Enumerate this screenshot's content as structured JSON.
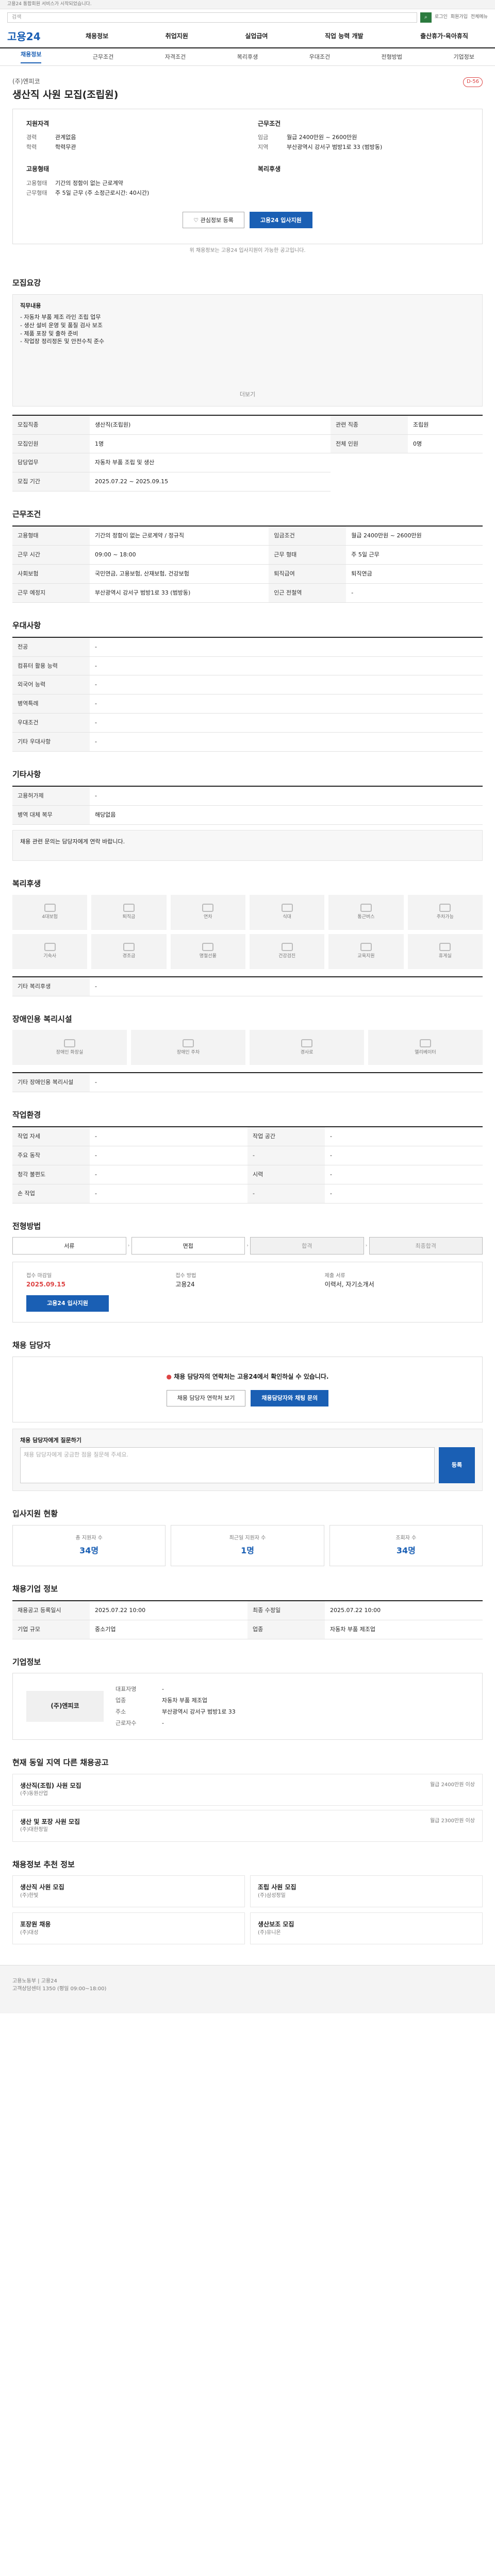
{
  "top": {
    "notice": "고용24 통합회원 서비스가 시작되었습니다.",
    "search_placeholder": "검색",
    "search_btn": "검색",
    "links": [
      "로그인",
      "회원가입",
      "전체메뉴"
    ]
  },
  "gnb": {
    "logo": "고용24",
    "items": [
      "채용정보",
      "취업지원",
      "실업급여",
      "직업 능력 개발",
      "출산휴가·육아휴직"
    ]
  },
  "tabs": [
    "채용정보",
    "근무조건",
    "자격조건",
    "복리후생",
    "우대조건",
    "전형방법",
    "기업정보"
  ],
  "header": {
    "company": "(주)엔피코",
    "title": "생산직 사원 모집(조립원)",
    "dday": "D-56"
  },
  "summary": {
    "left_title": "지원자격",
    "exp_label": "경력",
    "exp": "관계없음",
    "edu_label": "학력",
    "edu": "학력무관",
    "right_title": "근무조건",
    "pay_label": "임금",
    "pay": "월급 2400만원 ~ 2600만원",
    "loc_label": "지역",
    "loc": "부산광역시 강서구 범방1로 33 (범방동)",
    "type_title": "고용형태",
    "type_label": "고용형태",
    "type": "기간의 정함이 없는 근로계약",
    "hours_label": "근무형태",
    "hours": "주 5일 근무 (주 소정근로시간: 40시간)",
    "welfare_title": "복리후생"
  },
  "buttons": {
    "save": "관심정보 등록",
    "apply": "고용24 입사지원"
  },
  "note": "위 채용정보는 고용24 입사지원이 가능한 공고입니다.",
  "sec_recruit": {
    "title": "모집요강",
    "body_title": "직무내용",
    "body": "- 자동차 부품 제조 라인 조립 업무\n- 생산 설비 운영 및 품질 검사 보조\n- 제품 포장 및 출하 준비\n- 작업장 정리정돈 및 안전수칙 준수",
    "more": "더보기",
    "rows": [
      [
        "모집직종",
        "생산직(조립원)",
        "관련 직종",
        "조립원"
      ],
      [
        "모집인원",
        "1명",
        "전체 인원",
        "0명"
      ],
      [
        "담당업무",
        "자동차 부품 조립 및 생산",
        "",
        ""
      ],
      [
        "모집 기간",
        "2025.07.22 ~ 2025.09.15",
        "",
        ""
      ]
    ]
  },
  "sec_cond": {
    "title": "근무조건",
    "rows": [
      [
        "고용형태",
        "기간의 정함이 없는 근로계약 / 정규직",
        "임금조건",
        "월급 2400만원 ~ 2600만원"
      ],
      [
        "근무 시간",
        "09:00 ~ 18:00",
        "근무 형태",
        "주 5일 근무"
      ],
      [
        "사회보험",
        "국민연금, 고용보험, 산재보험, 건강보험",
        "퇴직급여",
        "퇴직연금"
      ],
      [
        "근무 예정지",
        "부산광역시 강서구 범방1로 33 (범방동)",
        "인근 전철역",
        "-"
      ]
    ]
  },
  "sec_req": {
    "title": "우대사항",
    "rows": [
      [
        "전공",
        "-"
      ],
      [
        "컴퓨터 활용 능력",
        "-"
      ],
      [
        "외국어 능력",
        "-"
      ],
      [
        "병역특례",
        "-"
      ],
      [
        "우대조건",
        "-"
      ],
      [
        "기타 우대사항",
        "-"
      ]
    ]
  },
  "sec_etc": {
    "title": "기타사항",
    "rows": [
      [
        "고용허가제",
        "-"
      ],
      [
        "병역 대체 복무",
        "해당없음"
      ]
    ],
    "extra": "채용 관련 문의는 담당자에게 연락 바랍니다."
  },
  "sec_welfare": {
    "title": "복리후생",
    "items": [
      "4대보험",
      "퇴직금",
      "연차",
      "식대",
      "통근버스",
      "주차가능",
      "기숙사",
      "경조금",
      "명절선물",
      "건강검진",
      "교육지원",
      "휴게실"
    ],
    "etc_label": "기타 복리후생",
    "etc": "-"
  },
  "sec_dis": {
    "title": "장애인용 복리시설",
    "items": [
      "장애인 화장실",
      "장애인 주차",
      "경사로",
      "엘리베이터"
    ],
    "etc_label": "기타 장애인용 복리시설",
    "etc": "-"
  },
  "sec_env": {
    "title": "작업환경",
    "rows": [
      [
        "작업 자세",
        "-",
        "작업 공간",
        "-"
      ],
      [
        "주요 동작",
        "-",
        "-",
        "-"
      ],
      [
        "청각 불편도",
        "-",
        "시력",
        "-"
      ],
      [
        "손 작업",
        "-",
        "-",
        "-"
      ]
    ]
  },
  "sec_proc": {
    "title": "전형방법",
    "steps": [
      "서류",
      "면접",
      "합격",
      "최종합격"
    ],
    "deadline_label": "접수 마감일",
    "deadline": "2025.09.15",
    "method_label": "접수 방법",
    "method": "고용24",
    "doc_label": "제출 서류",
    "doc": "이력서, 자기소개서",
    "apply": "고용24 입사지원"
  },
  "sec_contact": {
    "title": "채용 담당자",
    "alert": "채용 담당자의 연락처는 고용24에서 확인하실 수 있습니다.",
    "btns": [
      "채용 담당자 연락처 보기",
      "채용담당자와 채팅 문의"
    ]
  },
  "sec_qna": {
    "title": "채용 담당자에게 질문하기",
    "placeholder": "채용 담당자에게 궁금한 점을 질문해 주세요.",
    "submit": "등록"
  },
  "sec_stats": {
    "title": "입사지원 현황",
    "cards": [
      [
        "총 지원자 수",
        "34명"
      ],
      [
        "최근일 지원자 수",
        "1명"
      ],
      [
        "조회자 수",
        "34명"
      ]
    ]
  },
  "sec_info": {
    "title": "채용기업 정보",
    "rows": [
      [
        "채용공고 등록일시",
        "2025.07.22 10:00",
        "최종 수정일",
        "2025.07.22 10:00"
      ],
      [
        "기업 규모",
        "중소기업",
        "업종",
        "자동차 부품 제조업"
      ]
    ]
  },
  "sec_company": {
    "title": "기업정보",
    "name": "(주)엔피코",
    "rows": [
      [
        "대표자명",
        "-"
      ],
      [
        "업종",
        "자동차 부품 제조업"
      ],
      [
        "주소",
        "부산광역시 강서구 범방1로 33"
      ],
      [
        "근로자수",
        "-"
      ]
    ]
  },
  "related": {
    "title": "현재 동일 지역 다른 채용공고",
    "items": [
      {
        "title": "생산직(조립) 사원 모집",
        "company": "(주)동원산업",
        "pay": "월급 2400만원 이상"
      },
      {
        "title": "생산 및 포장 사원 모집",
        "company": "(주)대한정밀",
        "pay": "월급 2300만원 이상"
      }
    ]
  },
  "recommend": {
    "title": "채용정보 추천 정보",
    "items": [
      {
        "title": "생산직 사원 모집",
        "co": "(주)한빛"
      },
      {
        "title": "조립 사원 모집",
        "co": "(주)삼성정밀"
      },
      {
        "title": "포장원 채용",
        "co": "(주)대성"
      },
      {
        "title": "생산보조 모집",
        "co": "(주)유니온"
      }
    ]
  },
  "footer": {
    "lines": [
      "고용노동부 | 고용24",
      "고객상담센터 1350 (평일 09:00~18:00)"
    ]
  }
}
